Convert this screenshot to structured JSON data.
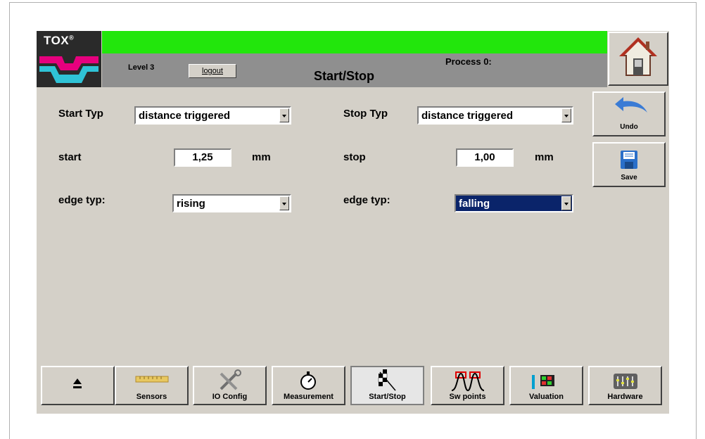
{
  "header": {
    "logo_text": "TOX",
    "logo_reg": "®",
    "level": "Level 3",
    "logout_label": "logout",
    "title": "Start/Stop",
    "process": "Process 0:"
  },
  "side_buttons": {
    "undo_label": "Undo",
    "save_label": "Save"
  },
  "form": {
    "start_typ_label": "Start Typ",
    "start_typ_value": "distance triggered",
    "stop_typ_label": "Stop Typ",
    "stop_typ_value": "distance triggered",
    "start_label": "start",
    "start_value": "1,25",
    "start_unit": "mm",
    "stop_label": "stop",
    "stop_value": "1,00",
    "stop_unit": "mm",
    "edge_left_label": "edge typ:",
    "edge_left_value": "rising",
    "edge_right_label": "edge typ:",
    "edge_right_value": "falling"
  },
  "tabs": [
    {
      "label": "",
      "icon": "eject-icon"
    },
    {
      "label": "Sensors",
      "icon": "ruler-icon"
    },
    {
      "label": "IO Config",
      "icon": "tools-icon"
    },
    {
      "label": "Measurement",
      "icon": "stopwatch-icon"
    },
    {
      "label": "Start/Stop",
      "icon": "checkered-flag-icon",
      "active": true
    },
    {
      "label": "Sw points",
      "icon": "pulse-icon"
    },
    {
      "label": "Valuation",
      "icon": "panel-icon"
    },
    {
      "label": "Hardware",
      "icon": "mixer-icon"
    }
  ],
  "colors": {
    "status_green": "#22e60c",
    "panel_gray": "#d4d0c8",
    "selection_blue": "#0a246a",
    "logo_magenta": "#e6007e",
    "logo_cyan": "#2fc3d6"
  }
}
